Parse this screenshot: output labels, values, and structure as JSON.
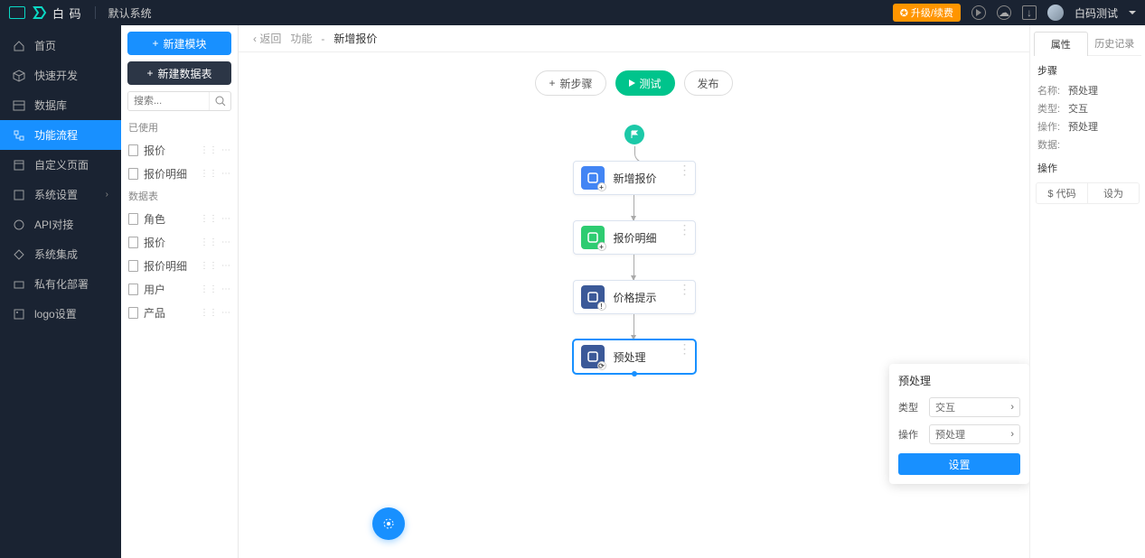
{
  "top": {
    "brand": "白 码",
    "system": "默认系统",
    "upgrade": "升级/续费",
    "user": "白码测试"
  },
  "nav": {
    "items": [
      {
        "label": "首页"
      },
      {
        "label": "快速开发"
      },
      {
        "label": "数据库"
      },
      {
        "label": "功能流程"
      },
      {
        "label": "自定义页面"
      },
      {
        "label": "系统设置",
        "expandable": true
      },
      {
        "label": "API对接"
      },
      {
        "label": "系统集成"
      },
      {
        "label": "私有化部署"
      },
      {
        "label": "logo设置"
      }
    ]
  },
  "modules": {
    "btn_new_module": "新建模块",
    "btn_new_table": "新建数据表",
    "search_placeholder": "搜索...",
    "group_used": "已使用",
    "used_items": [
      "报价",
      "报价明细"
    ],
    "group_tables": "数据表",
    "table_items": [
      "角色",
      "报价",
      "报价明细",
      "用户",
      "产品"
    ]
  },
  "crumb": {
    "back": "返回",
    "a": "功能",
    "b": "新增报价"
  },
  "toolbar": {
    "new_step": "新步骤",
    "test": "测试",
    "publish": "发布"
  },
  "flow": {
    "nodes": [
      {
        "label": "新增报价",
        "color": "blue",
        "sub": "+"
      },
      {
        "label": "报价明细",
        "color": "green",
        "sub": "+"
      },
      {
        "label": "价格提示",
        "color": "navy",
        "sub": "!"
      },
      {
        "label": "预处理",
        "color": "navy",
        "sub": "⟳",
        "selected": true
      }
    ]
  },
  "popup": {
    "title": "预处理",
    "rows": [
      {
        "label": "类型",
        "value": "交互"
      },
      {
        "label": "操作",
        "value": "预处理"
      }
    ],
    "button": "设置"
  },
  "props": {
    "tab_attr": "属性",
    "tab_history": "历史记录",
    "section_step": "步骤",
    "kv": [
      {
        "k": "名称:",
        "v": "预处理"
      },
      {
        "k": "类型:",
        "v": "交互"
      },
      {
        "k": "操作:",
        "v": "预处理"
      },
      {
        "k": "数据:",
        "v": ""
      }
    ],
    "section_ops": "操作",
    "op_code": "$ 代码",
    "op_set": "设为"
  }
}
